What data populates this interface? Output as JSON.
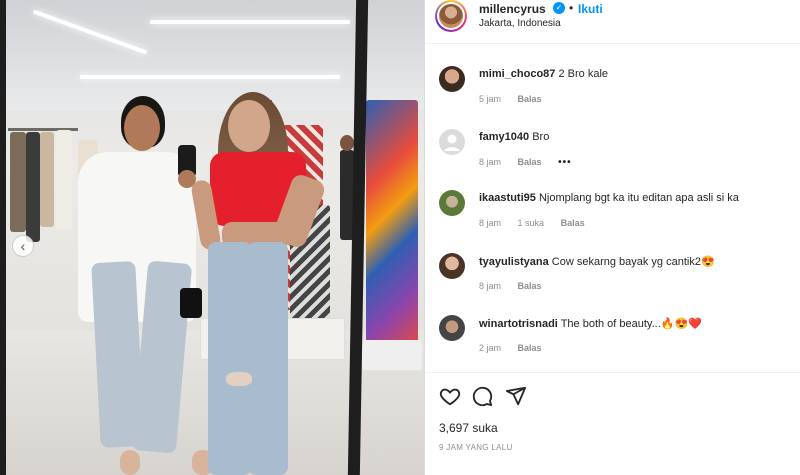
{
  "post": {
    "username": "millencyrus",
    "separator": "•",
    "follow_label": "Ikuti",
    "location": "Jakarta, Indonesia"
  },
  "comments": [
    {
      "username": "mimi_choco87",
      "text": "2 Bro kale",
      "time": "5 jam",
      "likes": "",
      "reply": "Balas",
      "more": ""
    },
    {
      "username": "famy1040",
      "text": "Bro",
      "time": "8 jam",
      "likes": "",
      "reply": "Balas",
      "more": "•••"
    },
    {
      "username": "ikaastuti95",
      "text": "Njomplang bgt ka itu editan apa asli si ka",
      "time": "8 jam",
      "likes": "1 suka",
      "reply": "Balas",
      "more": ""
    },
    {
      "username": "tyayulistyana",
      "text": "Cow sekarng bayak yg cantik2😍",
      "time": "8 jam",
      "likes": "",
      "reply": "Balas",
      "more": ""
    },
    {
      "username": "winartotrisnadi",
      "text": "The both of beauty...🔥😍❤️",
      "time": "2 jam",
      "likes": "",
      "reply": "Balas",
      "more": ""
    }
  ],
  "footer": {
    "likes": "3,697 suka",
    "time": "9 JAM YANG LALU"
  },
  "icons": {
    "like": "heart-icon",
    "comment": "comment-icon",
    "share": "share-icon",
    "verified": "verified-badge-icon",
    "carousel_prev": "chevron-left-icon"
  },
  "colors": {
    "accent": "#0095f6",
    "text": "#262626",
    "muted": "#8e8e8e"
  }
}
